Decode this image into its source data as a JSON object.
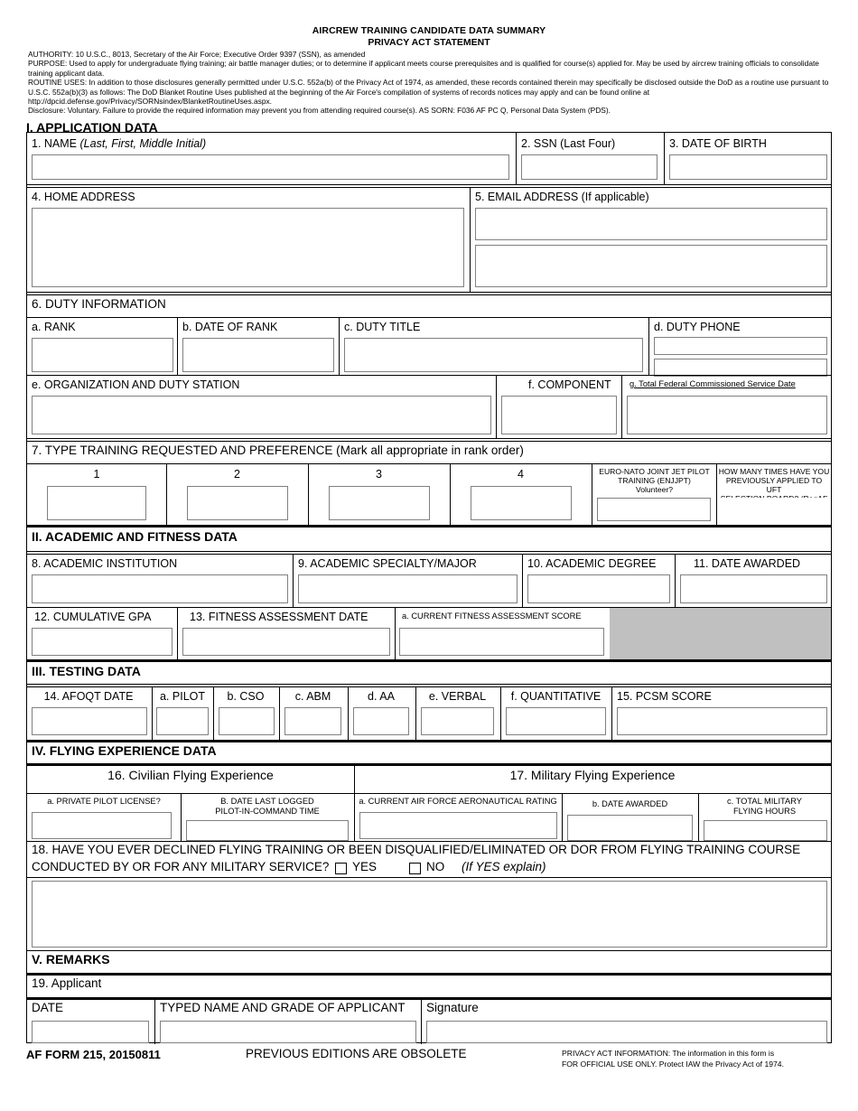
{
  "header": {
    "title": "AIRCREW TRAINING CANDIDATE DATA SUMMARY",
    "subtitle": "PRIVACY ACT STATEMENT",
    "authority": "AUTHORITY: 10 U.S.C., 8013, Secretary of the Air Force; Executive Order 9397 (SSN), as amended",
    "purpose": "PURPOSE: Used to apply for undergraduate flying training; air battle manager duties; or to determine if applicant meets course prerequisites and is qualified for course(s) applied for.  May be used by aircrew training officials to consolidate training applicant data.",
    "routine_uses": "ROUTINE USES: In addition to those disclosures generally permitted under U.S.C. 552a(b) of the Privacy Act of 1974, as amended, these records contained therein may specifically be disclosed outside the DoD as a routine use pursuant to U.S.C. 552a(b)(3) as follows: The DoD Blanket Routine Uses published at the beginning of the Air Force's compilation of systems of records notices may apply and can be found online at http://dpcid.defense.gov/Privacy/SORNsindex/BlanketRoutineUses.aspx.",
    "disclosure": "Disclosure: Voluntary.  Failure to provide the required information may prevent you from attending required course(s).  AS SORN: F036 AF PC Q, Personal Data System (PDS)."
  },
  "sections": {
    "s1": "I. APPLICATION DATA",
    "s2": "II. ACADEMIC AND FITNESS DATA",
    "s3": "III. TESTING DATA",
    "s4": "IV. FLYING EXPERIENCE DATA",
    "s5": "V. REMARKS"
  },
  "application": {
    "name_label": "1. NAME ",
    "name_label_italic": "(Last, First, Middle Initial)",
    "ssn_label": "2. SSN (Last Four)",
    "dob_label": "3. DATE OF BIRTH",
    "home_address_label": "4. HOME ADDRESS",
    "email_label": "5. EMAIL ADDRESS (If applicable)",
    "name_value": "",
    "ssn_value": "",
    "dob_value": "",
    "home_address_value": "",
    "email_value_1": "",
    "email_value_2": ""
  },
  "duty": {
    "heading": "6. DUTY INFORMATION",
    "rank_label": "a. RANK",
    "date_of_rank_label": "b. DATE OF RANK",
    "duty_title_label": "c. DUTY TITLE",
    "duty_phone_label": "d. DUTY PHONE",
    "org_label": "e. ORGANIZATION AND DUTY STATION",
    "component_label": "f. COMPONENT",
    "service_date_label": "g. Total Federal Commissioned Service Date",
    "rank_value": "",
    "date_of_rank_value": "",
    "duty_title_value": "",
    "duty_phone_value_1": "",
    "duty_phone_value_2": "",
    "org_value": "",
    "component_value": "",
    "service_date_value": ""
  },
  "training": {
    "heading": "7. TYPE TRAINING REQUESTED AND PREFERENCE (Mark all appropriate in rank order)",
    "pref_headers": [
      "1",
      "2",
      "3",
      "4"
    ],
    "pref_values": [
      "",
      "",
      "",
      ""
    ],
    "enjjpt_label_line1": "EURO-NATO JOINT JET PILOT",
    "enjjpt_label_line2": "TRAINING (ENJJPT)",
    "enjjpt_label_line3": "Volunteer?",
    "enjjpt_value": "",
    "uft_label_line1": "HOW MANY TIMES HAVE YOU",
    "uft_label_line2": "PREVIOUSLY APPLIED TO UFT",
    "uft_label_line3": "SELECTION BOARD? (ReqAF Only)",
    "uft_value": ""
  },
  "academic": {
    "institution_label": "8. ACADEMIC INSTITUTION",
    "specialty_label": "9. ACADEMIC SPECIALTY/MAJOR",
    "degree_label": "10. ACADEMIC DEGREE",
    "date_awarded_label": "11. DATE AWARDED",
    "gpa_label": "12. CUMULATIVE GPA",
    "fitness_date_label": "13.  FITNESS ASSESSMENT DATE",
    "fitness_score_label": "a. CURRENT FITNESS ASSESSMENT SCORE",
    "institution_value": "",
    "specialty_value": "",
    "degree_value": "",
    "date_awarded_value": "",
    "gpa_value": "",
    "fitness_date_value": "",
    "fitness_score_value": ""
  },
  "testing": {
    "afoqt_date_label": "14. AFOQT DATE",
    "pilot_label": "a. PILOT",
    "cso_label": "b. CSO",
    "abm_label": "c. ABM",
    "aa_label": "d. AA",
    "verbal_label": "e. VERBAL",
    "quantitative_label": "f. QUANTITATIVE",
    "pcsm_label": "15. PCSM SCORE",
    "afoqt_date_value": "",
    "pilot_value": "",
    "cso_value": "",
    "abm_value": "",
    "aa_value": "",
    "verbal_value": "",
    "quantitative_value": "",
    "pcsm_value": ""
  },
  "flying": {
    "civilian_header": "16. Civilian Flying Experience",
    "military_header": "17. Military Flying Experience",
    "ppl_label": "a. PRIVATE PILOT LICENSE?",
    "pic_label_line1": "B. DATE LAST LOGGED",
    "pic_label_line2": "PILOT-IN-COMMAND TIME",
    "rating_label": "a. CURRENT AIR FORCE AERONAUTICAL RATING",
    "date_awarded_label": "b. DATE AWARDED",
    "hours_label_line1": "c. TOTAL MILITARY",
    "hours_label_line2": "FLYING HOURS",
    "ppl_value": "",
    "pic_value": "",
    "rating_value": "",
    "date_awarded_value": "",
    "hours_value": ""
  },
  "question18": {
    "line1": "18. HAVE YOU EVER DECLINED FLYING TRAINING OR BEEN DISQUALIFIED/ELIMINATED OR DOR FROM FLYING TRAINING COURSE",
    "line2": "CONDUCTED BY OR FOR ANY MILITARY SERVICE?",
    "yes_label": "YES",
    "no_label": "NO",
    "hint": "(If YES explain)",
    "yes_checked": false,
    "no_checked": false,
    "explanation_value": ""
  },
  "remarks": {
    "applicant_label": "19. Applicant",
    "date_label": "DATE",
    "typed_name_label": "TYPED NAME AND GRADE OF APPLICANT",
    "signature_label": "Signature",
    "date_value": "",
    "typed_name_value": "",
    "signature_value": ""
  },
  "footer": {
    "form_id": "AF FORM 215, 20150811",
    "obsolete": "PREVIOUS EDITIONS ARE OBSOLETE",
    "privacy_line1": "PRIVACY ACT INFORMATION: The information in this form is",
    "privacy_line2": "FOR OFFICIAL USE ONLY.  Protect IAW the Privacy Act of 1974."
  }
}
